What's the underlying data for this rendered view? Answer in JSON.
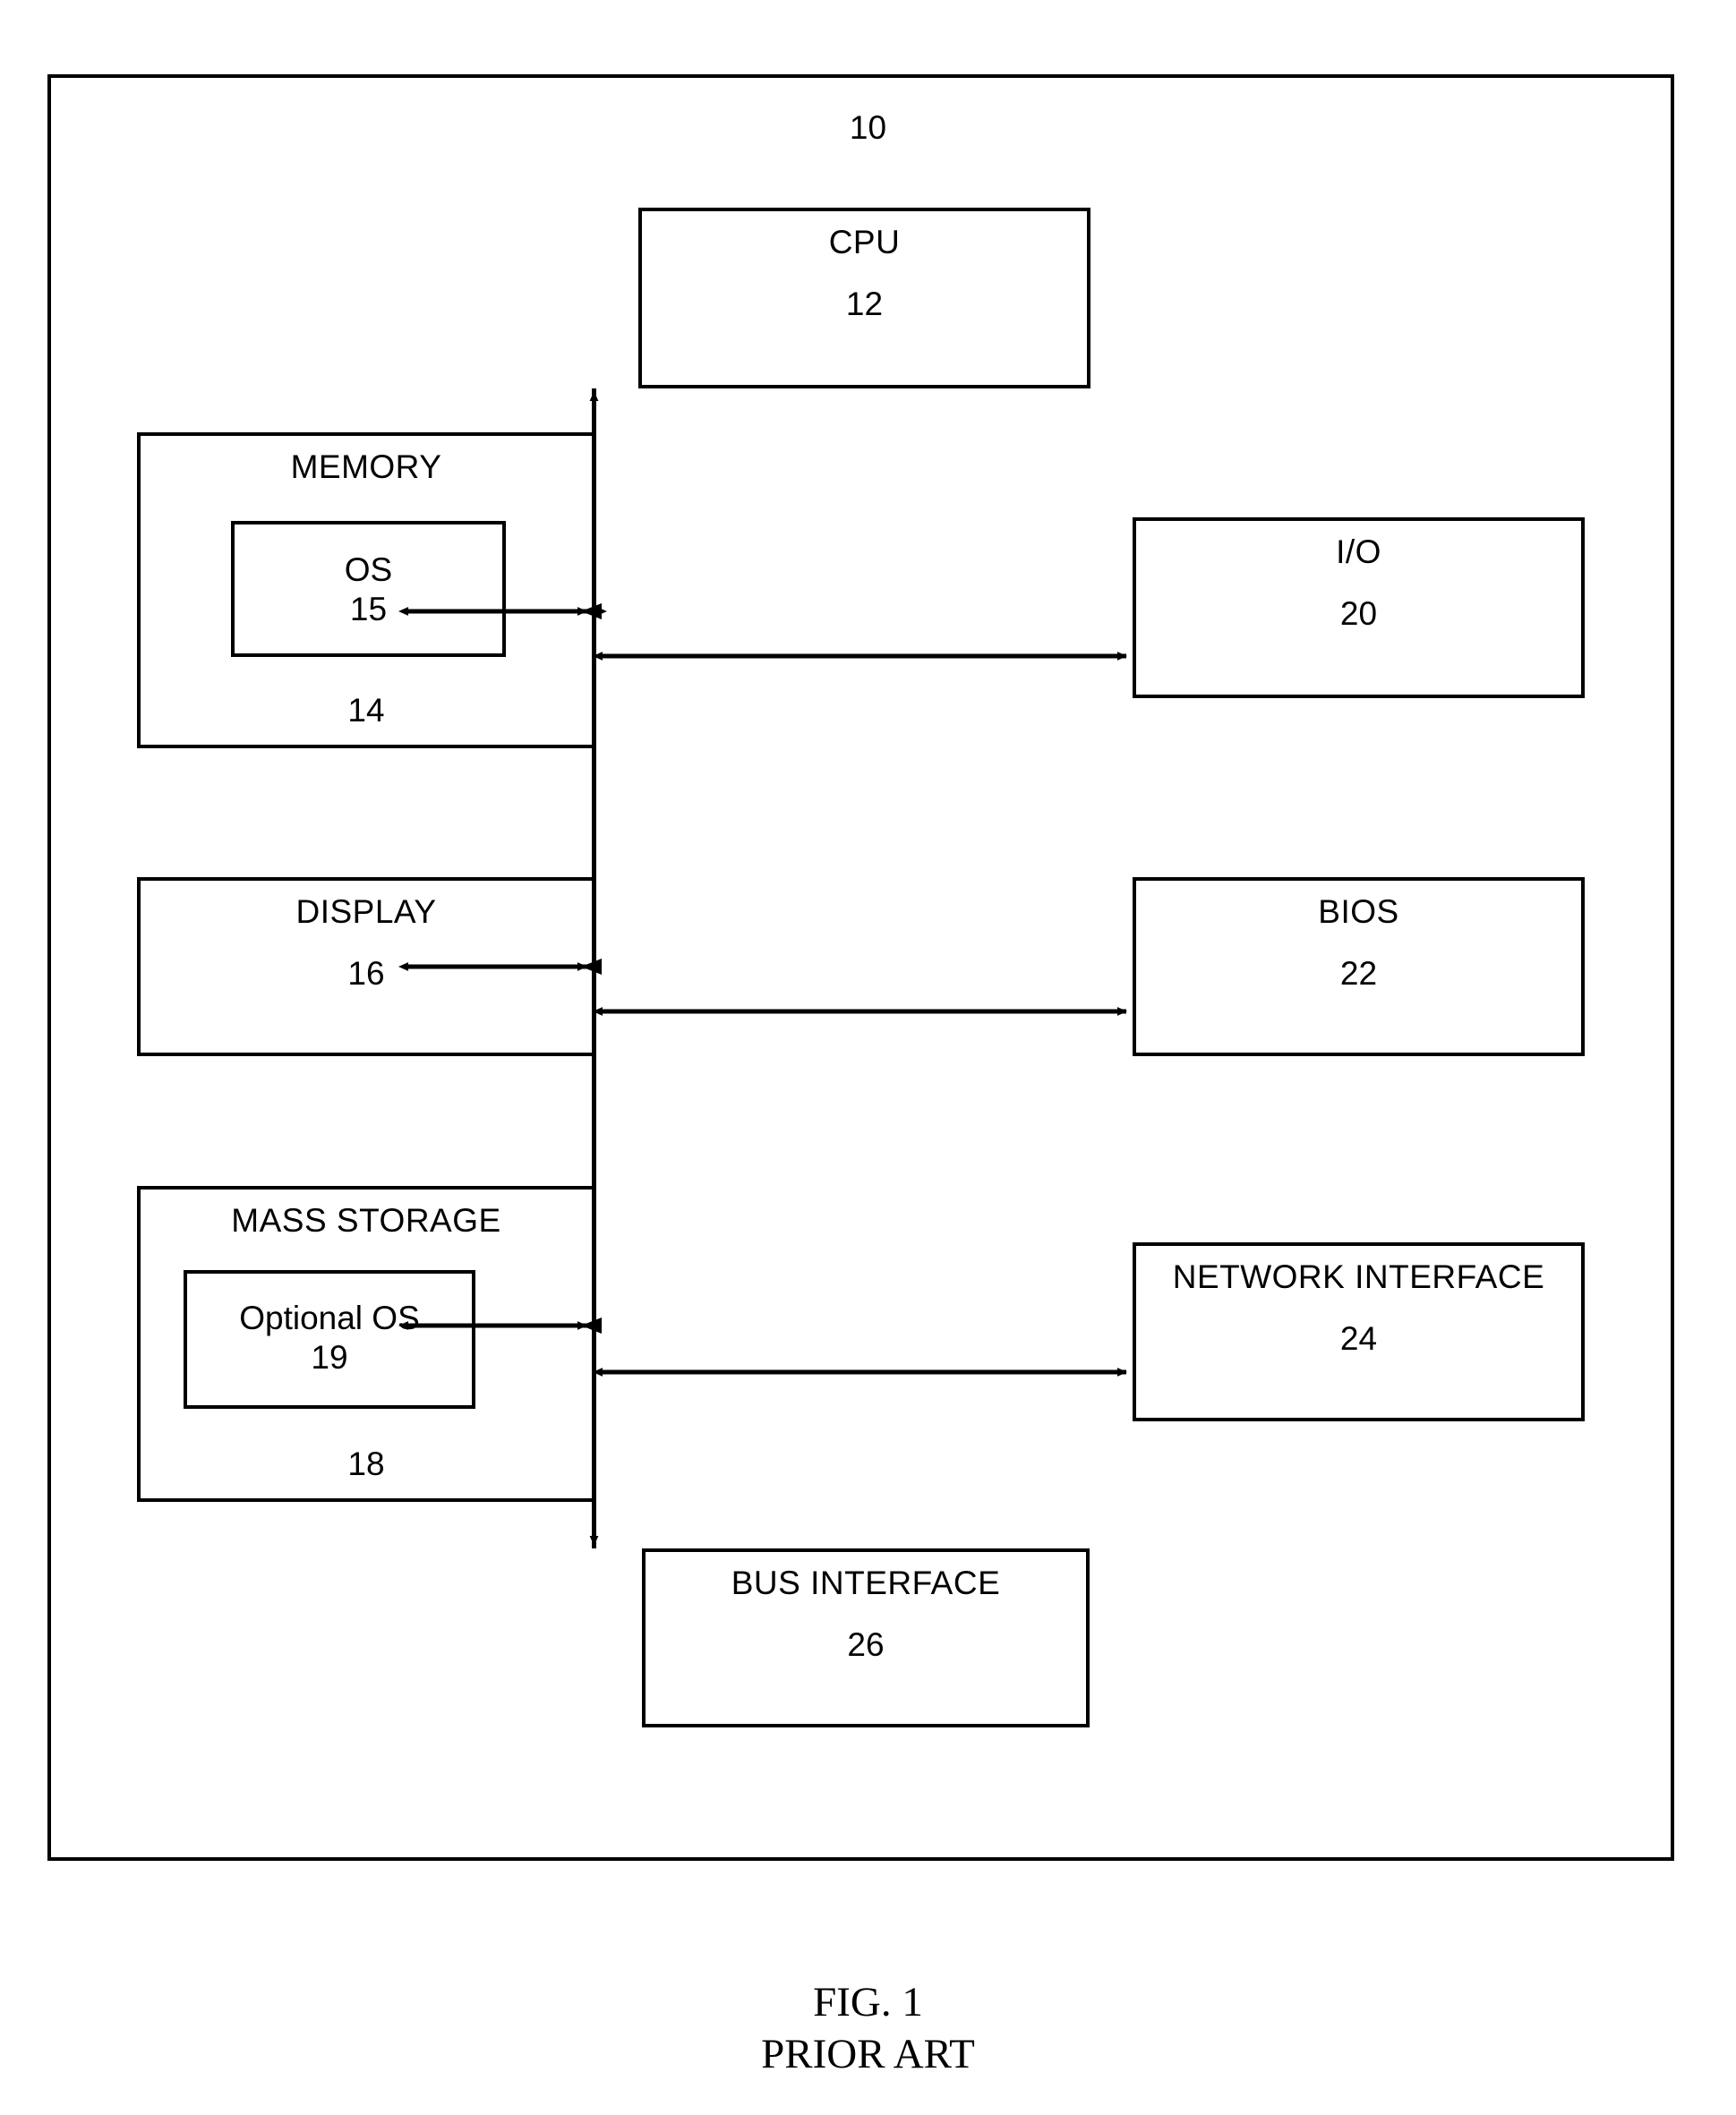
{
  "figure": {
    "system_ref": "10",
    "caption_line1": "FIG. 1",
    "caption_line2": "PRIOR ART"
  },
  "nodes": {
    "cpu": {
      "title": "CPU",
      "ref": "12"
    },
    "memory": {
      "title": "MEMORY",
      "ref": "14"
    },
    "os": {
      "title": "OS",
      "ref": "15"
    },
    "display": {
      "title": "DISPLAY",
      "ref": "16"
    },
    "mass_storage": {
      "title": "MASS STORAGE",
      "ref": "18"
    },
    "optional_os": {
      "title": "Optional OS",
      "ref": "19"
    },
    "io": {
      "title": "I/O",
      "ref": "20"
    },
    "bios": {
      "title": "BIOS",
      "ref": "22"
    },
    "network": {
      "title": "NETWORK INTERFACE",
      "ref": "24"
    },
    "bus": {
      "title": "BUS INTERFACE",
      "ref": "26"
    }
  },
  "connections": [
    {
      "from": "bus",
      "to": "cpu",
      "kind": "single-arrow-up"
    },
    {
      "from": "memory",
      "to": "bus",
      "kind": "double-arrow-horizontal"
    },
    {
      "from": "bus",
      "to": "io",
      "kind": "double-arrow-horizontal"
    },
    {
      "from": "display",
      "to": "bus",
      "kind": "double-arrow-horizontal"
    },
    {
      "from": "bus",
      "to": "bios",
      "kind": "double-arrow-horizontal"
    },
    {
      "from": "mass_storage",
      "to": "bus",
      "kind": "double-arrow-horizontal"
    },
    {
      "from": "bus",
      "to": "network",
      "kind": "double-arrow-horizontal"
    },
    {
      "from": "bus",
      "to": "bus_interface",
      "kind": "single-arrow-down"
    }
  ],
  "style": {
    "line_color": "#000000",
    "background": "#ffffff"
  }
}
